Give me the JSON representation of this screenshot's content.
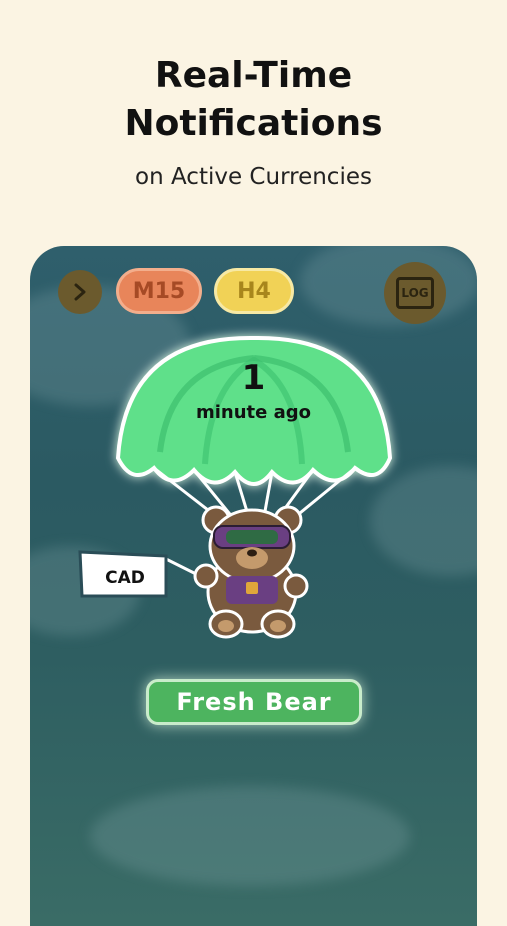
{
  "header": {
    "title_line1": "Real-Time",
    "title_line2": "Notifications",
    "subtitle": "on Active Currencies"
  },
  "toolbar": {
    "back_icon": "chevron-right-icon",
    "timeframes": [
      {
        "label": "M15",
        "color": "#e8855a"
      },
      {
        "label": "H4",
        "color": "#f1d256"
      }
    ],
    "log_label": "LOG"
  },
  "notification": {
    "count": "1",
    "unit": "minute ago",
    "currency": "CAD",
    "status": "Fresh Bear",
    "parachute_color": "#5ee08a",
    "status_color": "#4db45f"
  }
}
